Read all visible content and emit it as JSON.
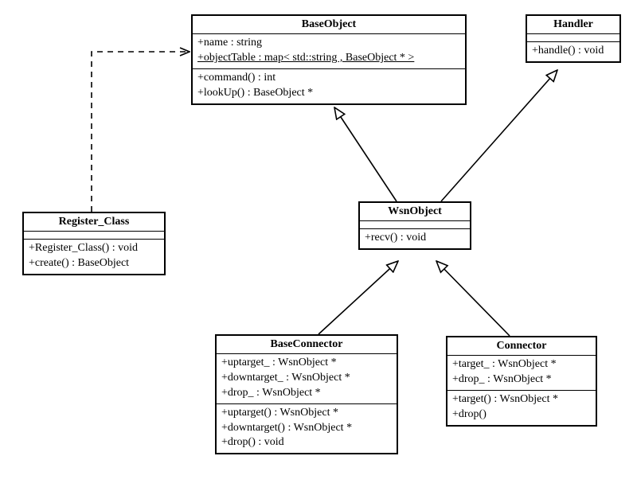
{
  "diagram_type": "UML Class Diagram",
  "classes": {
    "BaseObject": {
      "name": "BaseObject",
      "attributes": [
        "+name : string",
        "+objectTable : map< std::string , BaseObject * >"
      ],
      "operations": [
        "+command() : int",
        "+lookUp() : BaseObject *"
      ]
    },
    "Handler": {
      "name": "Handler",
      "attributes": [],
      "operations": [
        "+handle() : void"
      ]
    },
    "Register_Class": {
      "name": "Register_Class",
      "attributes": [],
      "operations": [
        "+Register_Class() : void",
        "+create() : BaseObject"
      ]
    },
    "WsnObject": {
      "name": "WsnObject",
      "attributes": [],
      "operations": [
        "+recv() : void"
      ]
    },
    "BaseConnector": {
      "name": "BaseConnector",
      "attributes": [
        "+uptarget_ : WsnObject *",
        "+downtarget_ : WsnObject *",
        "+drop_ : WsnObject *"
      ],
      "operations": [
        "+uptarget() : WsnObject *",
        "+downtarget() : WsnObject *",
        "+drop() : void"
      ]
    },
    "Connector": {
      "name": "Connector",
      "attributes": [
        "+target_ : WsnObject *",
        "+drop_ : WsnObject *"
      ],
      "operations": [
        "+target() : WsnObject *",
        "+drop()"
      ]
    }
  },
  "relationships": [
    {
      "from": "WsnObject",
      "to": "BaseObject",
      "type": "generalization"
    },
    {
      "from": "WsnObject",
      "to": "Handler",
      "type": "generalization"
    },
    {
      "from": "BaseConnector",
      "to": "WsnObject",
      "type": "generalization"
    },
    {
      "from": "Connector",
      "to": "WsnObject",
      "type": "generalization"
    },
    {
      "from": "Register_Class",
      "to": "BaseObject",
      "type": "dependency",
      "style": "dashed"
    }
  ]
}
